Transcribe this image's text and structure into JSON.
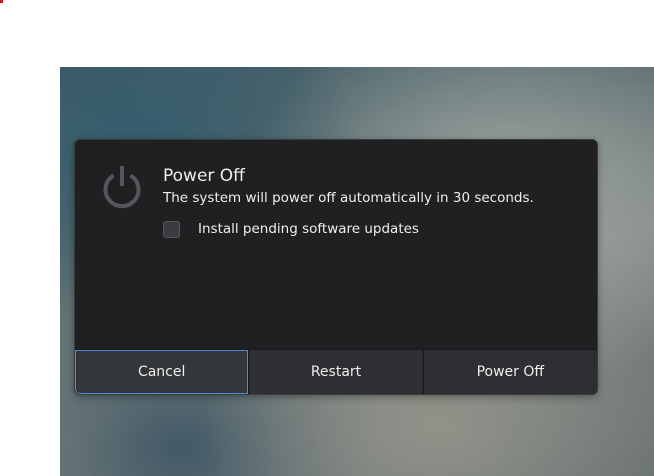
{
  "dialog": {
    "icon": "power-icon",
    "title": "Power Off",
    "message": "The system will power off automatically in 30 seconds.",
    "checkbox_label": "Install pending software updates",
    "checkbox_checked": false
  },
  "buttons": {
    "cancel": "Cancel",
    "restart": "Restart",
    "power_off": "Power Off"
  },
  "colors": {
    "dialog_bg": "#1f2022",
    "button_bg": "#2d2f32",
    "focus_ring": "#4a90d9",
    "text": "#eeeeec"
  }
}
